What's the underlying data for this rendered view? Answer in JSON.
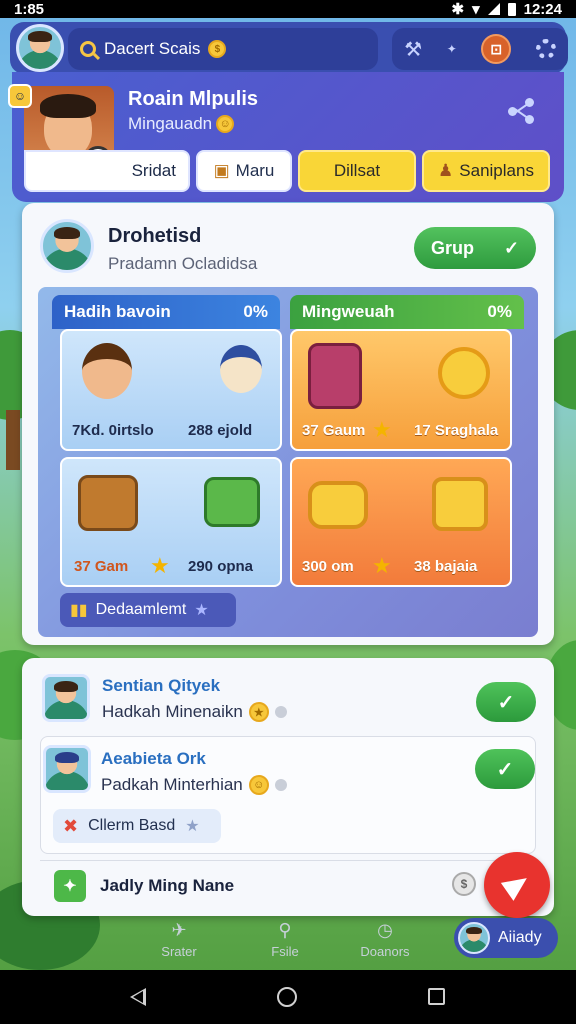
{
  "status_bar": {
    "time_left": "1:85",
    "time_right": "12:24"
  },
  "top_bar": {
    "search_text": "Dacert Scais"
  },
  "profile": {
    "name": "Roain Mlpulis",
    "subtitle": "Mingauadn",
    "pills": [
      "Sridat",
      "Maru",
      "Dillsat",
      "Saniplans"
    ]
  },
  "panel": {
    "title": "Drohetisd",
    "subtitle": "Pradamn Ocladidsa",
    "group_button": "Grup",
    "columns": [
      {
        "label": "Hadih bavoin",
        "percent": "0%"
      },
      {
        "label": "Mingweuah",
        "percent": "0%"
      }
    ],
    "tiles": [
      {
        "left": "7Kd. 0irtslo",
        "right": "288 ejold"
      },
      {
        "left": "37 Gaum",
        "right": "17 Sraghala"
      },
      {
        "left": "37 Gam",
        "right": "290 opna"
      },
      {
        "left": "300 om",
        "right": "38 bajaia"
      }
    ],
    "dashboard_pill": "Dedaamlemt"
  },
  "list": {
    "rows": [
      {
        "title": "Sentian Qityek",
        "subtitle": "Hadkah Minenaikn"
      },
      {
        "title": "Aeabieta Ork",
        "subtitle": "Padkah Minterhian",
        "chip": "Cllerm Basd"
      }
    ],
    "bottom_row": "Jadly Ming Nane"
  },
  "bottom_nav": {
    "items": [
      "Srater",
      "Fsile",
      "Doanors"
    ],
    "user_chip": "Aiiady"
  },
  "colors": {
    "accent": "#3a4fb0",
    "green": "#2e9b3e",
    "yellow": "#f9d637",
    "fab": "#e8332e"
  }
}
